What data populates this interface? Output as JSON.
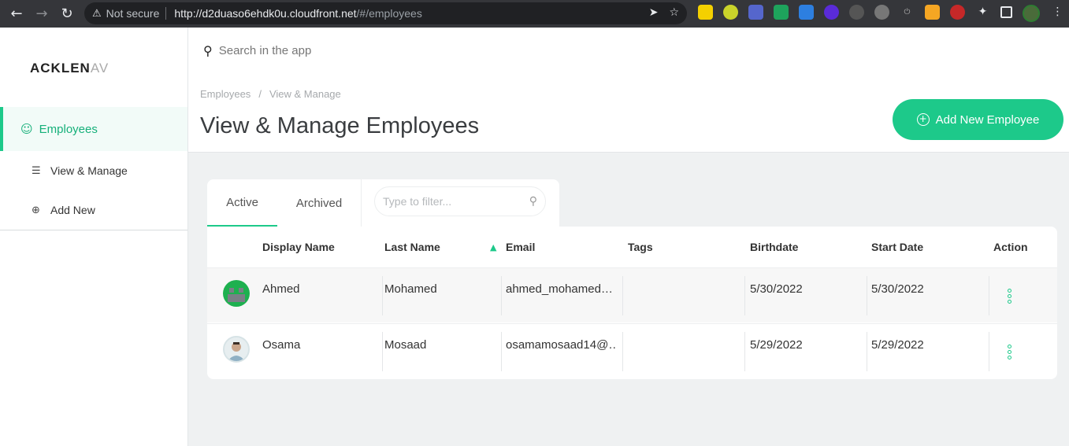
{
  "browser": {
    "not_secure_label": "Not secure",
    "url_host": "http://d2duaso6ehdk0u.cloudfront.net",
    "url_path": "/#/employees"
  },
  "app": {
    "logo_text": "ACKLEN",
    "logo_fade": "AV",
    "search_placeholder": "Search in the app"
  },
  "sidebar": {
    "main_item": "Employees",
    "sub_items": [
      {
        "label": "View & Manage",
        "icon": "list-icon"
      },
      {
        "label": "Add New",
        "icon": "plus-circle-icon"
      }
    ]
  },
  "header": {
    "breadcrumb": [
      "Employees",
      "View & Manage"
    ],
    "breadcrumb_sep": "/",
    "title": "View & Manage Employees",
    "add_button": "Add New Employee"
  },
  "tabs": {
    "active": "Active",
    "archived": "Archived",
    "filter_placeholder": "Type to filter..."
  },
  "table": {
    "columns": [
      "Display Name",
      "Last Name",
      "Email",
      "Tags",
      "Birthdate",
      "Start Date",
      "Action"
    ],
    "rows": [
      {
        "display_name": "Ahmed",
        "last_name": "Mohamed",
        "email": "ahmed_mohamed…",
        "tags": "",
        "birthdate": "5/30/2022",
        "start_date": "5/30/2022"
      },
      {
        "display_name": "Osama",
        "last_name": "Mosaad",
        "email": "osamamosaad14@…",
        "tags": "",
        "birthdate": "5/29/2022",
        "start_date": "5/29/2022"
      }
    ]
  },
  "colors": {
    "accent": "#1dc98a",
    "content_bg": "#eff1f2"
  }
}
